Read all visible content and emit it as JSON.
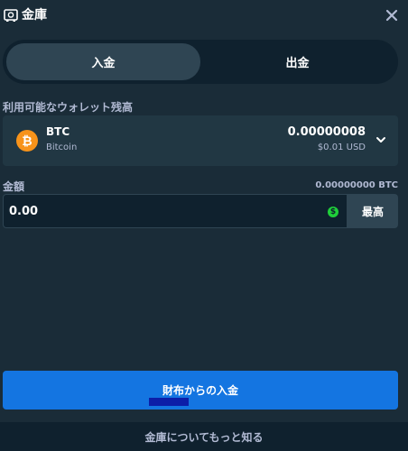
{
  "header": {
    "title": "金庫",
    "vault_icon": "vault-icon",
    "close_icon": "close-icon"
  },
  "tabs": [
    {
      "label": "入金",
      "active": true
    },
    {
      "label": "出金",
      "active": false
    }
  ],
  "wallet": {
    "label": "利用可能なウォレット残高",
    "coin_code": "BTC",
    "coin_name": "Bitcoin",
    "balance_crypto": "0.00000008",
    "balance_usd": "$0.01 USD",
    "coin_icon_glyph": "₿"
  },
  "amount": {
    "label": "金額",
    "crypto_readout": "0.00000000 BTC",
    "value": "0.00",
    "max_label": "最高",
    "currency_badge_glyph": "$"
  },
  "actions": {
    "deposit_label": "財布からの入金"
  },
  "footer": {
    "link": "金庫についてもっと知る"
  },
  "colors": {
    "background": "#1a2c38",
    "panel": "#213743",
    "input": "#0f212e",
    "accent": "#1475e1",
    "bitcoin": "#f7931a",
    "money_green": "#1fcf3a"
  }
}
